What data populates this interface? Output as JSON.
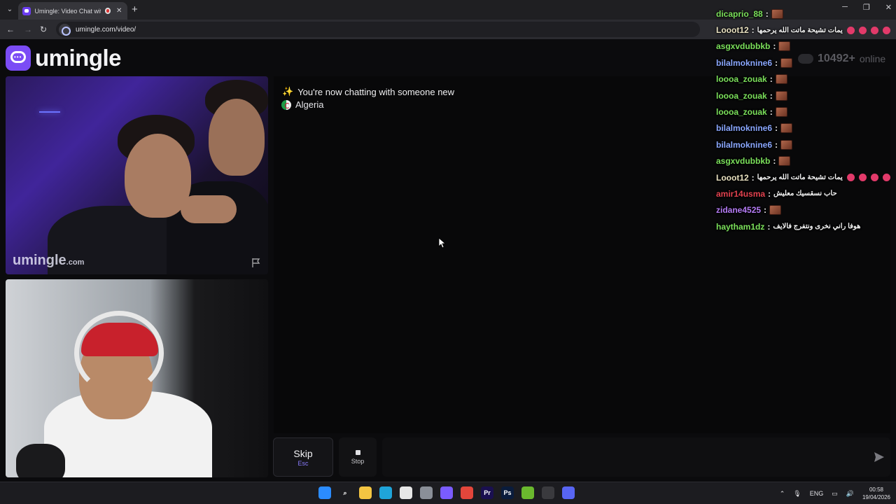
{
  "browser": {
    "tab_title": "Umingle: Video Chat with S",
    "url": "umingle.com/video/",
    "new_tab_symbol": "+",
    "close_symbol": "✕"
  },
  "site": {
    "brand": "umingle",
    "online_count": "10492+",
    "online_label": "online",
    "watermark_main": "umingle",
    "watermark_suffix": ".com"
  },
  "chat": {
    "system_message": "You're now chatting with someone new",
    "country": "Algeria",
    "input_value": ""
  },
  "controls": {
    "skip_label": "Skip",
    "skip_key": "Esc",
    "stop_label": "Stop"
  },
  "live_chat": [
    {
      "user": "dicaprio_88",
      "color": "#7be05b",
      "text": "",
      "emote": true,
      "hearts": 0
    },
    {
      "user": "Looot12",
      "color": "#e8e0c0",
      "text": "يمات تشيحة ماتت الله يرحمها",
      "emote": false,
      "hearts": 4
    },
    {
      "user": "asgxvdubbkb",
      "color": "#7be05b",
      "text": "",
      "emote": true,
      "hearts": 0
    },
    {
      "user": "bilalmoknine6",
      "color": "#8aa7ff",
      "text": "",
      "emote": true,
      "hearts": 0
    },
    {
      "user": "loooa_zouak",
      "color": "#7be05b",
      "text": "",
      "emote": true,
      "hearts": 0
    },
    {
      "user": "loooa_zouak",
      "color": "#7be05b",
      "text": "",
      "emote": true,
      "hearts": 0
    },
    {
      "user": "loooa_zouak",
      "color": "#7be05b",
      "text": "",
      "emote": true,
      "hearts": 0
    },
    {
      "user": "bilalmoknine6",
      "color": "#8aa7ff",
      "text": "",
      "emote": true,
      "hearts": 0
    },
    {
      "user": "bilalmoknine6",
      "color": "#8aa7ff",
      "text": "",
      "emote": true,
      "hearts": 0
    },
    {
      "user": "asgxvdubbkb",
      "color": "#7be05b",
      "text": "",
      "emote": true,
      "hearts": 0
    },
    {
      "user": "Looot12",
      "color": "#e8e0c0",
      "text": "يمات تشيحة ماتت الله يرحمها",
      "emote": false,
      "hearts": 4
    },
    {
      "user": "amir14usma",
      "color": "#e2424f",
      "text": "حاب نسقسيك معليش",
      "emote": false,
      "hearts": 0
    },
    {
      "user": "zidane4525",
      "color": "#b57cf5",
      "text": "",
      "emote": true,
      "hearts": 0
    },
    {
      "user": "haytham1dz",
      "color": "#7be05b",
      "text": "هوفا راني نخرى ونتفرج فالايف",
      "emote": false,
      "hearts": 0
    }
  ],
  "taskbar": {
    "language": "ENG",
    "time": "00:58",
    "date": "19/04/2026",
    "apps": [
      {
        "name": "windows-start-icon",
        "label": "",
        "color": "#2b8cff"
      },
      {
        "name": "search-icon",
        "label": "⌕",
        "color": "transparent"
      },
      {
        "name": "file-explorer-icon",
        "label": "",
        "color": "#f4c542"
      },
      {
        "name": "edge-icon",
        "label": "",
        "color": "#1fa4d9"
      },
      {
        "name": "store-icon",
        "label": "",
        "color": "#e7e7e7"
      },
      {
        "name": "settings-icon",
        "label": "",
        "color": "#8a8f98"
      },
      {
        "name": "twitch-app-icon",
        "label": "",
        "color": "#7a5cff"
      },
      {
        "name": "chrome-icon",
        "label": "",
        "color": "#e3463b"
      },
      {
        "name": "premiere-icon",
        "label": "Pr",
        "color": "#1a1050"
      },
      {
        "name": "photoshop-icon",
        "label": "Ps",
        "color": "#0a1c3c"
      },
      {
        "name": "utorrent-icon",
        "label": "",
        "color": "#6ab82e"
      },
      {
        "name": "recorder-icon",
        "label": "",
        "color": "#3a3a3e"
      },
      {
        "name": "discord-icon",
        "label": "",
        "color": "#5865f2"
      }
    ]
  },
  "colors": {
    "accent": "#7b4cf5",
    "background": "#0b0b0d"
  }
}
